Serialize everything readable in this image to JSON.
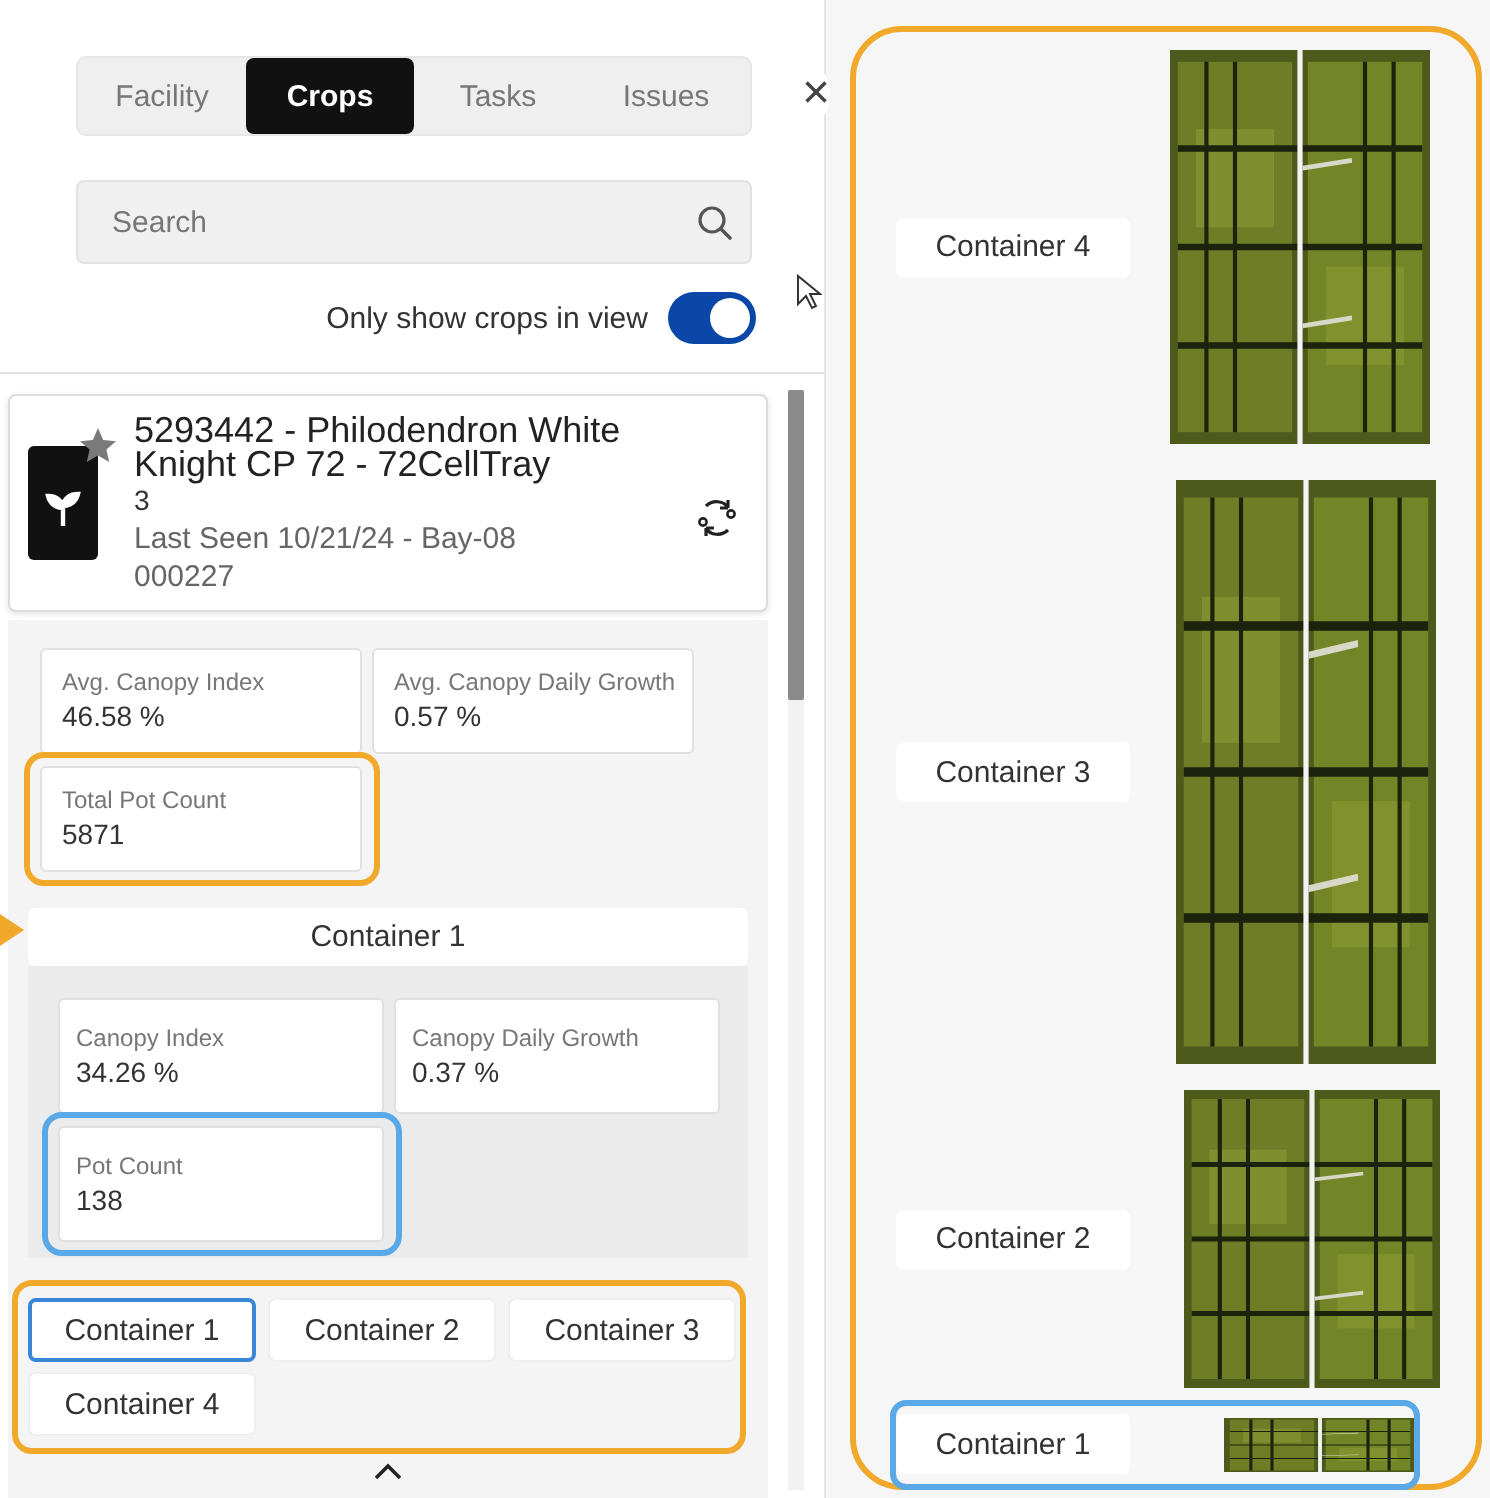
{
  "tabs": [
    {
      "label": "Facility",
      "selected": false
    },
    {
      "label": "Crops",
      "selected": true
    },
    {
      "label": "Tasks",
      "selected": false
    },
    {
      "label": "Issues",
      "selected": false
    }
  ],
  "close_button": {
    "label": "×"
  },
  "search": {
    "placeholder": "Search"
  },
  "filter_toggle": {
    "label": "Only show crops in view",
    "on": true
  },
  "crop_card": {
    "title": "5293442 - Philodendron White Knight CP 72 - 72CellTray",
    "lines": [
      "3",
      "Last Seen 10/21/24 - Bay-08",
      "000227"
    ]
  },
  "summary_metrics": [
    {
      "label": "Avg. Canopy Index",
      "value": "46.58 %"
    },
    {
      "label": "Avg. Canopy Daily Growth",
      "value": "0.57 %"
    },
    {
      "label": "Total Pot Count",
      "value": "5871",
      "color": "#f0a92b"
    }
  ],
  "container_detail": {
    "title": "Container 1",
    "arrow_marker": true,
    "metrics": [
      {
        "label": "Canopy Index",
        "value": "34.26 %"
      },
      {
        "label": "Canopy Daily Growth",
        "value": "0.37 %"
      },
      {
        "label": "Pot Count",
        "value": "138",
        "color": "#5aa9e6"
      }
    ]
  },
  "container_buttons": {
    "color": "#f0a92b",
    "items": [
      {
        "label": "Container 1",
        "selected": true
      },
      {
        "label": "Container 2",
        "selected": false
      },
      {
        "label": "Container 3",
        "selected": false
      },
      {
        "label": "Container 4",
        "selected": false
      }
    ]
  },
  "map": {
    "color": "#f0a92b",
    "containers": [
      {
        "label": "Container 4"
      },
      {
        "label": "Container 3"
      },
      {
        "label": "Container 2"
      },
      {
        "label": "Container 1",
        "color": "#5aa9e6"
      }
    ]
  }
}
